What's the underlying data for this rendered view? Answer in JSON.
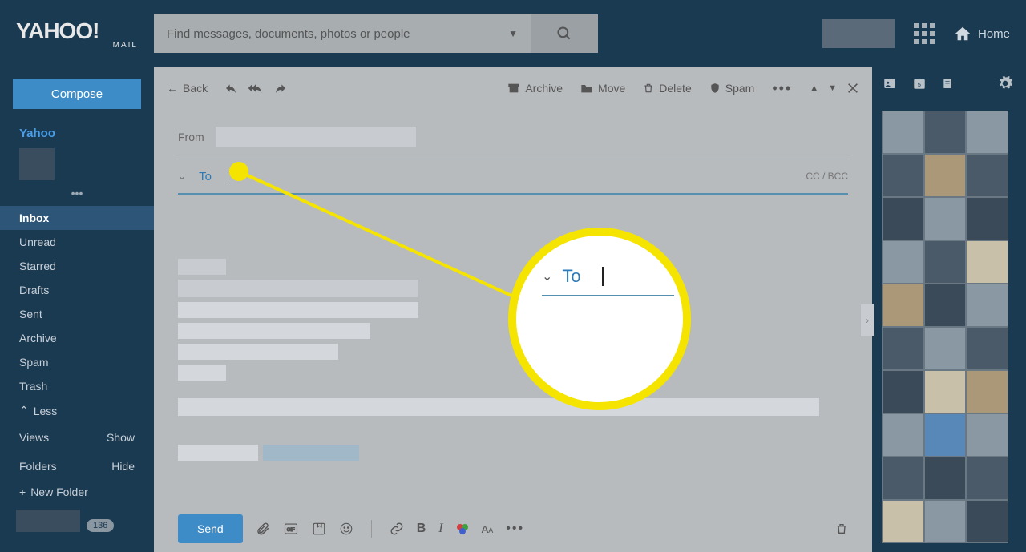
{
  "header": {
    "logo": "YAHOO!",
    "logo_sub": "MAIL",
    "search_placeholder": "Find messages, documents, photos or people",
    "home": "Home"
  },
  "sidebar": {
    "compose": "Compose",
    "account": "Yahoo",
    "items": [
      {
        "label": "Inbox",
        "active": true
      },
      {
        "label": "Unread"
      },
      {
        "label": "Starred"
      },
      {
        "label": "Drafts"
      },
      {
        "label": "Sent"
      },
      {
        "label": "Archive"
      },
      {
        "label": "Spam"
      },
      {
        "label": "Trash"
      }
    ],
    "less": "Less",
    "views": "Views",
    "show": "Show",
    "folders": "Folders",
    "hide": "Hide",
    "newfolder": "New Folder",
    "count": "136"
  },
  "toolbar": {
    "back": "Back",
    "archive": "Archive",
    "move": "Move",
    "delete": "Delete",
    "spam": "Spam"
  },
  "compose": {
    "from": "From",
    "to": "To",
    "ccbcc": "CC / BCC",
    "send": "Send"
  },
  "magnify": {
    "to": "To"
  }
}
